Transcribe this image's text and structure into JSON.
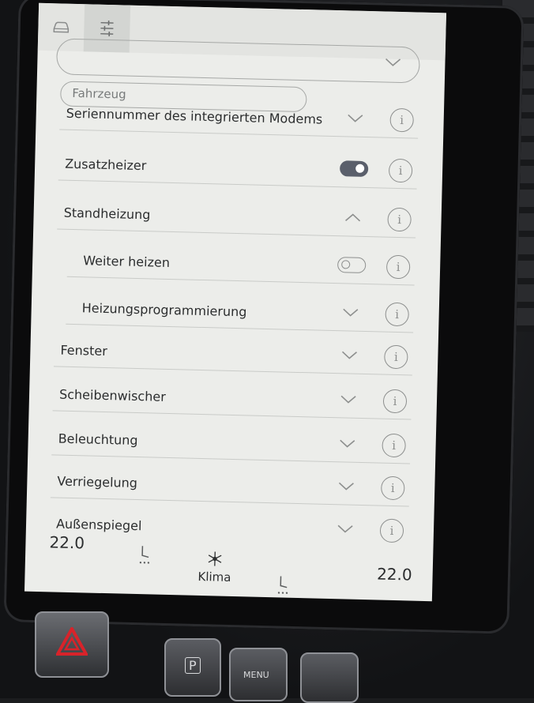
{
  "tabs": [
    {
      "icon": "car-icon"
    },
    {
      "icon": "sliders-icon"
    }
  ],
  "category": {
    "value": "Fahrzeug"
  },
  "rows": [
    {
      "label": "Seriennummer des integrierten Modems",
      "control": "chevron-down"
    },
    {
      "label": "Zusatzheizer",
      "control": "toggle-on"
    },
    {
      "label": "Standheizung",
      "control": "chevron-up"
    },
    {
      "label": "Weiter heizen",
      "control": "toggle-off"
    },
    {
      "label": "Heizungsprogrammierung",
      "control": "chevron-down"
    },
    {
      "label": "Fenster",
      "control": "chevron-down"
    },
    {
      "label": "Scheibenwischer",
      "control": "chevron-down"
    },
    {
      "label": "Beleuchtung",
      "control": "chevron-down"
    },
    {
      "label": "Verriegelung",
      "control": "chevron-down"
    },
    {
      "label": "Außenspiegel",
      "control": "chevron-down"
    }
  ],
  "info_glyph": "i",
  "bottom_bar": {
    "temp_left": "22.0",
    "temp_right": "22.0",
    "klima_label": "Klima"
  },
  "physical_buttons": {
    "park_label": "P",
    "menu_label": "MENU"
  },
  "colors": {
    "screen_bg": "#ecedea",
    "toggle_on": "#5a5f6b",
    "hazard": "#d8232a"
  }
}
